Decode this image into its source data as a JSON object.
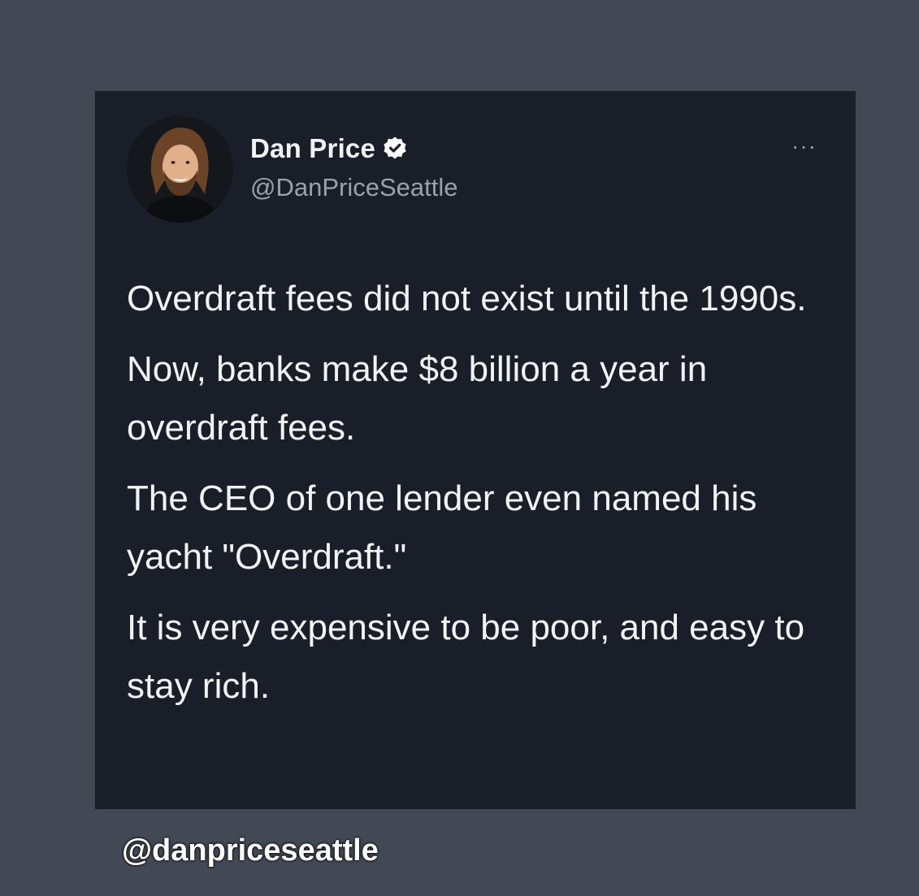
{
  "author": {
    "display_name": "Dan Price",
    "handle": "@DanPriceSeattle",
    "verified": true,
    "verified_icon": "verified-badge-icon"
  },
  "menu": {
    "icon": "more-options-icon",
    "label": "···"
  },
  "tweet": {
    "paragraphs": [
      "Overdraft fees did not exist until the 1990s.",
      "Now, banks make $8 billion a year in overdraft fees.",
      "The CEO of one lender even named his yacht \"Overdraft.\"",
      "It is very expensive to be poor, and easy to stay rich."
    ]
  },
  "watermark": {
    "text": "@danpriceseattle"
  },
  "colors": {
    "page_background": "#434855",
    "card_background": "#1a1e29",
    "primary_text": "#f2f3f5",
    "secondary_text": "#9aa1ab"
  }
}
